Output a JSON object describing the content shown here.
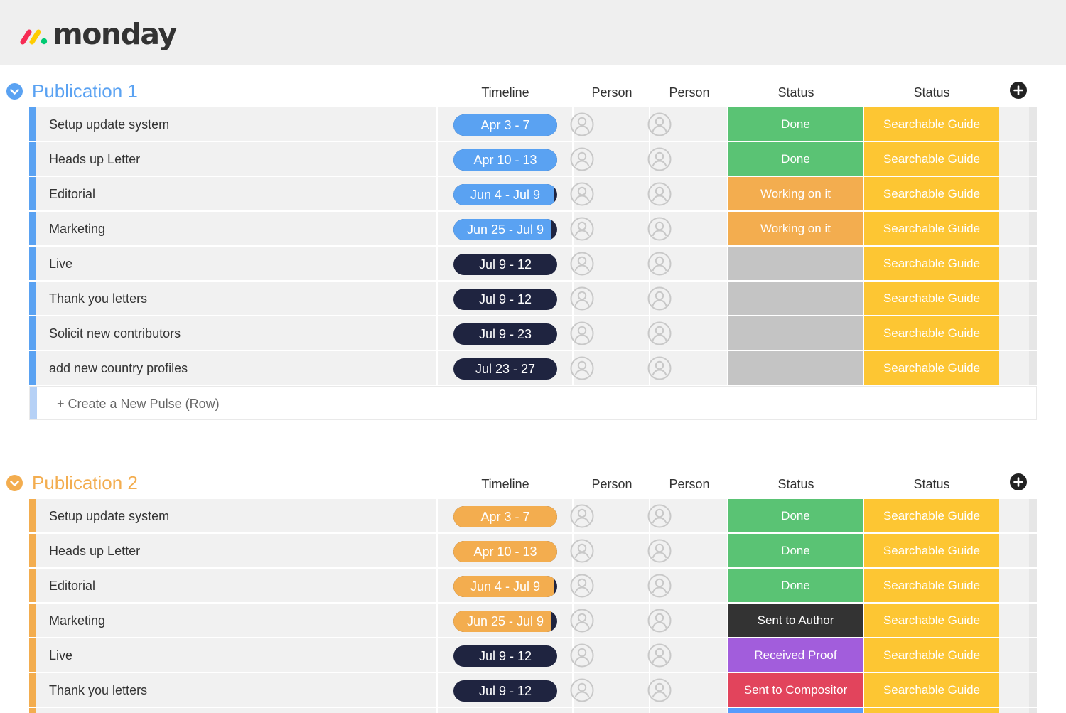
{
  "app": {
    "logo_text": "monday"
  },
  "colors": {
    "blue": "#5aa2f2",
    "orange": "#f3ad4f",
    "dark": "#1f2440",
    "done": "#5ac374",
    "working": "#f3ad4f",
    "empty": "#c4c4c4",
    "sent_author": "#333333",
    "received": "#a25ddc",
    "compositor": "#e2445c",
    "guide": "#fdc633",
    "next": "#579bfc"
  },
  "columns": [
    "Timeline",
    "Person",
    "Person",
    "Status",
    "Status"
  ],
  "groups": [
    {
      "title": "Publication 1",
      "color": "#5aa2f2",
      "create_label": "+ Create a New Pulse (Row)",
      "rows": [
        {
          "name": "Setup update system",
          "timeline": "Apr 3 - 7",
          "timeline_color": "#5aa2f2",
          "timeline_progress": 1.0,
          "status": "Done",
          "status_color": "#5ac374",
          "status2": "Searchable Guide"
        },
        {
          "name": "Heads up Letter",
          "timeline": "Apr 10 - 13",
          "timeline_color": "#5aa2f2",
          "timeline_progress": 1.0,
          "status": "Done",
          "status_color": "#5ac374",
          "status2": "Searchable Guide"
        },
        {
          "name": "Editorial",
          "timeline": "Jun 4 - Jul 9",
          "timeline_color": "#5aa2f2",
          "timeline_progress": 0.97,
          "status": "Working on it",
          "status_color": "#f3ad4f",
          "status2": "Searchable Guide"
        },
        {
          "name": "Marketing",
          "timeline": "Jun 25 - Jul 9",
          "timeline_color": "#5aa2f2",
          "timeline_progress": 0.94,
          "status": "Working on it",
          "status_color": "#f3ad4f",
          "status2": "Searchable Guide"
        },
        {
          "name": "Live",
          "timeline": "Jul 9 - 12",
          "timeline_color": "#1f2440",
          "timeline_progress": 0.0,
          "status": "",
          "status_color": "#c4c4c4",
          "status2": "Searchable Guide"
        },
        {
          "name": "Thank you letters",
          "timeline": "Jul 9 - 12",
          "timeline_color": "#1f2440",
          "timeline_progress": 0.0,
          "status": "",
          "status_color": "#c4c4c4",
          "status2": "Searchable Guide"
        },
        {
          "name": "Solicit new contributors",
          "timeline": "Jul 9 - 23",
          "timeline_color": "#1f2440",
          "timeline_progress": 0.0,
          "status": "",
          "status_color": "#c4c4c4",
          "status2": "Searchable Guide"
        },
        {
          "name": "add new country profiles",
          "timeline": "Jul 23 - 27",
          "timeline_color": "#1f2440",
          "timeline_progress": 0.0,
          "status": "",
          "status_color": "#c4c4c4",
          "status2": "Searchable Guide"
        }
      ]
    },
    {
      "title": "Publication 2",
      "color": "#f3ad4f",
      "create_label": "",
      "rows": [
        {
          "name": "Setup update system",
          "timeline": "Apr 3 - 7",
          "timeline_color": "#f3ad4f",
          "timeline_progress": 1.0,
          "status": "Done",
          "status_color": "#5ac374",
          "status2": "Searchable Guide"
        },
        {
          "name": "Heads up Letter",
          "timeline": "Apr 10 - 13",
          "timeline_color": "#f3ad4f",
          "timeline_progress": 1.0,
          "status": "Done",
          "status_color": "#5ac374",
          "status2": "Searchable Guide"
        },
        {
          "name": "Editorial",
          "timeline": "Jun 4 - Jul 9",
          "timeline_color": "#f3ad4f",
          "timeline_progress": 0.97,
          "status": "Done",
          "status_color": "#5ac374",
          "status2": "Searchable Guide"
        },
        {
          "name": "Marketing",
          "timeline": "Jun 25 - Jul 9",
          "timeline_color": "#f3ad4f",
          "timeline_progress": 0.94,
          "status": "Sent to Author",
          "status_color": "#333333",
          "status2": "Searchable Guide"
        },
        {
          "name": "Live",
          "timeline": "Jul 9 - 12",
          "timeline_color": "#1f2440",
          "timeline_progress": 0.0,
          "status": "Received Proof",
          "status_color": "#a25ddc",
          "status2": "Searchable Guide"
        },
        {
          "name": "Thank you letters",
          "timeline": "Jul 9 - 12",
          "timeline_color": "#1f2440",
          "timeline_progress": 0.0,
          "status": "Sent to Compositor",
          "status_color": "#e2445c",
          "status2": "Searchable Guide"
        },
        {
          "name": "",
          "timeline": "",
          "timeline_color": "#1f2440",
          "timeline_progress": 0.0,
          "status": "",
          "status_color": "#579bfc",
          "status2": ""
        }
      ]
    }
  ]
}
